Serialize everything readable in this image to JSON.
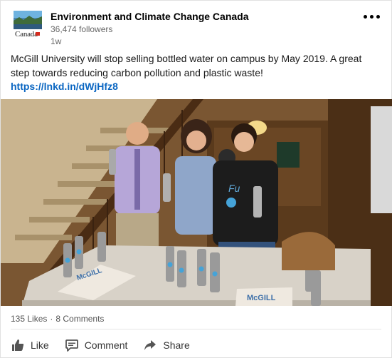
{
  "post": {
    "author": "Environment and Climate Change Canada",
    "followers": "36,474 followers",
    "time": "1w",
    "logo_word": "Canada",
    "body": "McGill University will stop selling bottled water on campus by May 2019. A great step towards reducing carbon pollution and plastic waste!",
    "link": "https://lnkd.in/dWjHfz8"
  },
  "image": {
    "poster_text": "McGILL",
    "shirt_text": "Fu"
  },
  "stats": {
    "likes": "135 Likes",
    "separator": "·",
    "comments": "8 Comments"
  },
  "actions": {
    "like": "Like",
    "comment": "Comment",
    "share": "Share"
  },
  "icons": {
    "more": "more-options-icon",
    "like": "thumbs-up-icon",
    "comment": "comment-icon",
    "share": "share-arrow-icon"
  },
  "colors": {
    "link": "#0a66c2",
    "canada_red": "#d52b1e"
  }
}
